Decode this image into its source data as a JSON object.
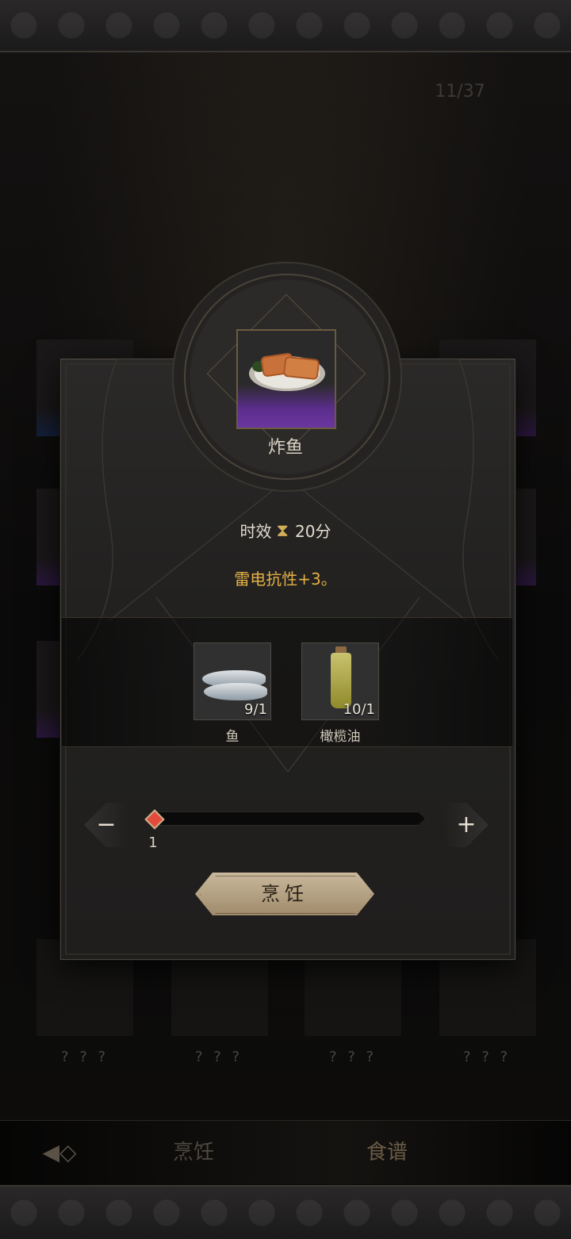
{
  "header": {
    "counter": "11/37"
  },
  "background_grid": {
    "unknown_labels": [
      "? ? ?",
      "? ? ?",
      "? ? ?",
      "? ? ?"
    ]
  },
  "bottom_nav": {
    "tab_cook": "烹饪",
    "tab_recipe": "食谱",
    "back_icon": "back-arrow-icon"
  },
  "dialog": {
    "item_name": "炸鱼",
    "item_rarity_color": "#6a36a0",
    "duration_label": "时效",
    "duration_icon": "hourglass-icon",
    "duration_value": "20分",
    "effect": "雷电抗性+3。",
    "ingredients": [
      {
        "name": "鱼",
        "count": "9/1",
        "icon": "fish-icon"
      },
      {
        "name": "橄榄油",
        "count": "10/1",
        "icon": "olive-oil-icon"
      }
    ],
    "quantity": {
      "minus_label": "−",
      "plus_label": "+",
      "value": "1",
      "fill_fraction": 0.0
    },
    "cook_button": "烹饪"
  },
  "colors": {
    "accent_gold": "#e3b045",
    "button_bg": "#c9b89c",
    "slider_knob": "#e24b3b"
  }
}
